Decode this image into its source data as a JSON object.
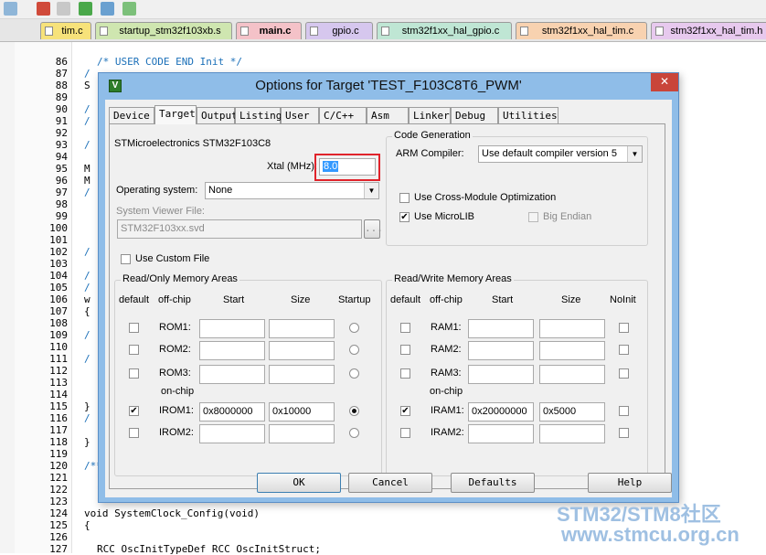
{
  "file_tabs": [
    {
      "label": "tim.c",
      "color": "#f7e27a",
      "active": false
    },
    {
      "label": "startup_stm32f103xb.s",
      "color": "#cfe6b0",
      "active": false
    },
    {
      "label": "main.c",
      "color": "#f4c2c8",
      "active": true
    },
    {
      "label": "gpio.c",
      "color": "#d6c7ee",
      "active": false
    },
    {
      "label": "stm32f1xx_hal_gpio.c",
      "color": "#bfe6d4",
      "active": false
    },
    {
      "label": "stm32f1xx_hal_tim.c",
      "color": "#f8d2b0",
      "active": false
    },
    {
      "label": "stm32f1xx_hal_tim.h",
      "color": "#e7c9ee",
      "active": false
    }
  ],
  "editor": {
    "line_numbers": [
      "86",
      "87",
      "88",
      "89",
      "90",
      "91",
      "92",
      "93",
      "94",
      "95",
      "96",
      "97",
      "98",
      "99",
      "100",
      "101",
      "102",
      "103",
      "104",
      "105",
      "106",
      "107",
      "108",
      "109",
      "110",
      "111",
      "112",
      "113",
      "114",
      "115",
      "116",
      "117",
      "118",
      "119",
      "120",
      "121",
      "122",
      "123",
      "124",
      "125",
      "126",
      "127"
    ],
    "line86": "/* USER CODE END Init */",
    "left_fragments": [
      "/",
      "S",
      "/",
      "/",
      "/",
      "M",
      "M",
      "/",
      "/",
      "/",
      "/",
      "w",
      "{",
      "/",
      "/",
      "}",
      "/"
    ],
    "line118": "}",
    "line120": "/**",
    "line121": "*",
    "line122": "*",
    "line123": "*",
    "line124": "void SystemClock_Config(void)",
    "line125": "{",
    "line127": "RCC OscInitTypeDef RCC OscInitStruct;"
  },
  "dialog": {
    "title": "Options for Target 'TEST_F103C8T6_PWM'",
    "close": "✕",
    "app_icon": "V",
    "tabs": [
      "Device",
      "Target",
      "Output",
      "Listing",
      "User",
      "C/C++",
      "Asm",
      "Linker",
      "Debug",
      "Utilities"
    ],
    "active_tab": "Target",
    "device_name": "STMicroelectronics STM32F103C8",
    "xtal_label": "Xtal (MHz):",
    "xtal_value": "8.0",
    "os_label": "Operating system:",
    "os_value": "None",
    "svf_label": "System Viewer File:",
    "svf_value": "STM32F103xx.svd",
    "svf_browse": "...",
    "custom_file_label": "Use Custom File",
    "code_gen": {
      "title": "Code Generation",
      "compiler_label": "ARM Compiler:",
      "compiler_value": "Use default compiler version 5",
      "cross_module": "Use Cross-Module Optimization",
      "microlib": "Use MicroLIB",
      "big_endian": "Big Endian"
    },
    "rom": {
      "title": "Read/Only Memory Areas",
      "headers": {
        "default": "default",
        "offchip": "off-chip",
        "start": "Start",
        "size": "Size",
        "startup": "Startup"
      },
      "on_chip_label": "on-chip",
      "rows": [
        {
          "name": "ROM1:",
          "start": "",
          "size": "",
          "default_checked": false,
          "startup": false
        },
        {
          "name": "ROM2:",
          "start": "",
          "size": "",
          "default_checked": false,
          "startup": false
        },
        {
          "name": "ROM3:",
          "start": "",
          "size": "",
          "default_checked": false,
          "startup": false
        },
        {
          "name": "IROM1:",
          "start": "0x8000000",
          "size": "0x10000",
          "default_checked": true,
          "startup": true
        },
        {
          "name": "IROM2:",
          "start": "",
          "size": "",
          "default_checked": false,
          "startup": false
        }
      ]
    },
    "ram": {
      "title": "Read/Write Memory Areas",
      "headers": {
        "default": "default",
        "offchip": "off-chip",
        "start": "Start",
        "size": "Size",
        "noinit": "NoInit"
      },
      "on_chip_label": "on-chip",
      "rows": [
        {
          "name": "RAM1:",
          "start": "",
          "size": "",
          "default_checked": false
        },
        {
          "name": "RAM2:",
          "start": "",
          "size": "",
          "default_checked": false
        },
        {
          "name": "RAM3:",
          "start": "",
          "size": "",
          "default_checked": false
        },
        {
          "name": "IRAM1:",
          "start": "0x20000000",
          "size": "0x5000",
          "default_checked": true
        },
        {
          "name": "IRAM2:",
          "start": "",
          "size": "",
          "default_checked": false
        }
      ]
    },
    "buttons": {
      "ok": "OK",
      "cancel": "Cancel",
      "defaults": "Defaults",
      "help": "Help"
    }
  },
  "watermark": {
    "line1": "STM32/STM8社区",
    "line2": "www.stmcu.org.cn"
  },
  "colors": {
    "accent_highlight": "#e0232b",
    "comment_blue": "#1a6fb8",
    "dialog_frame": "#8fbde8"
  }
}
